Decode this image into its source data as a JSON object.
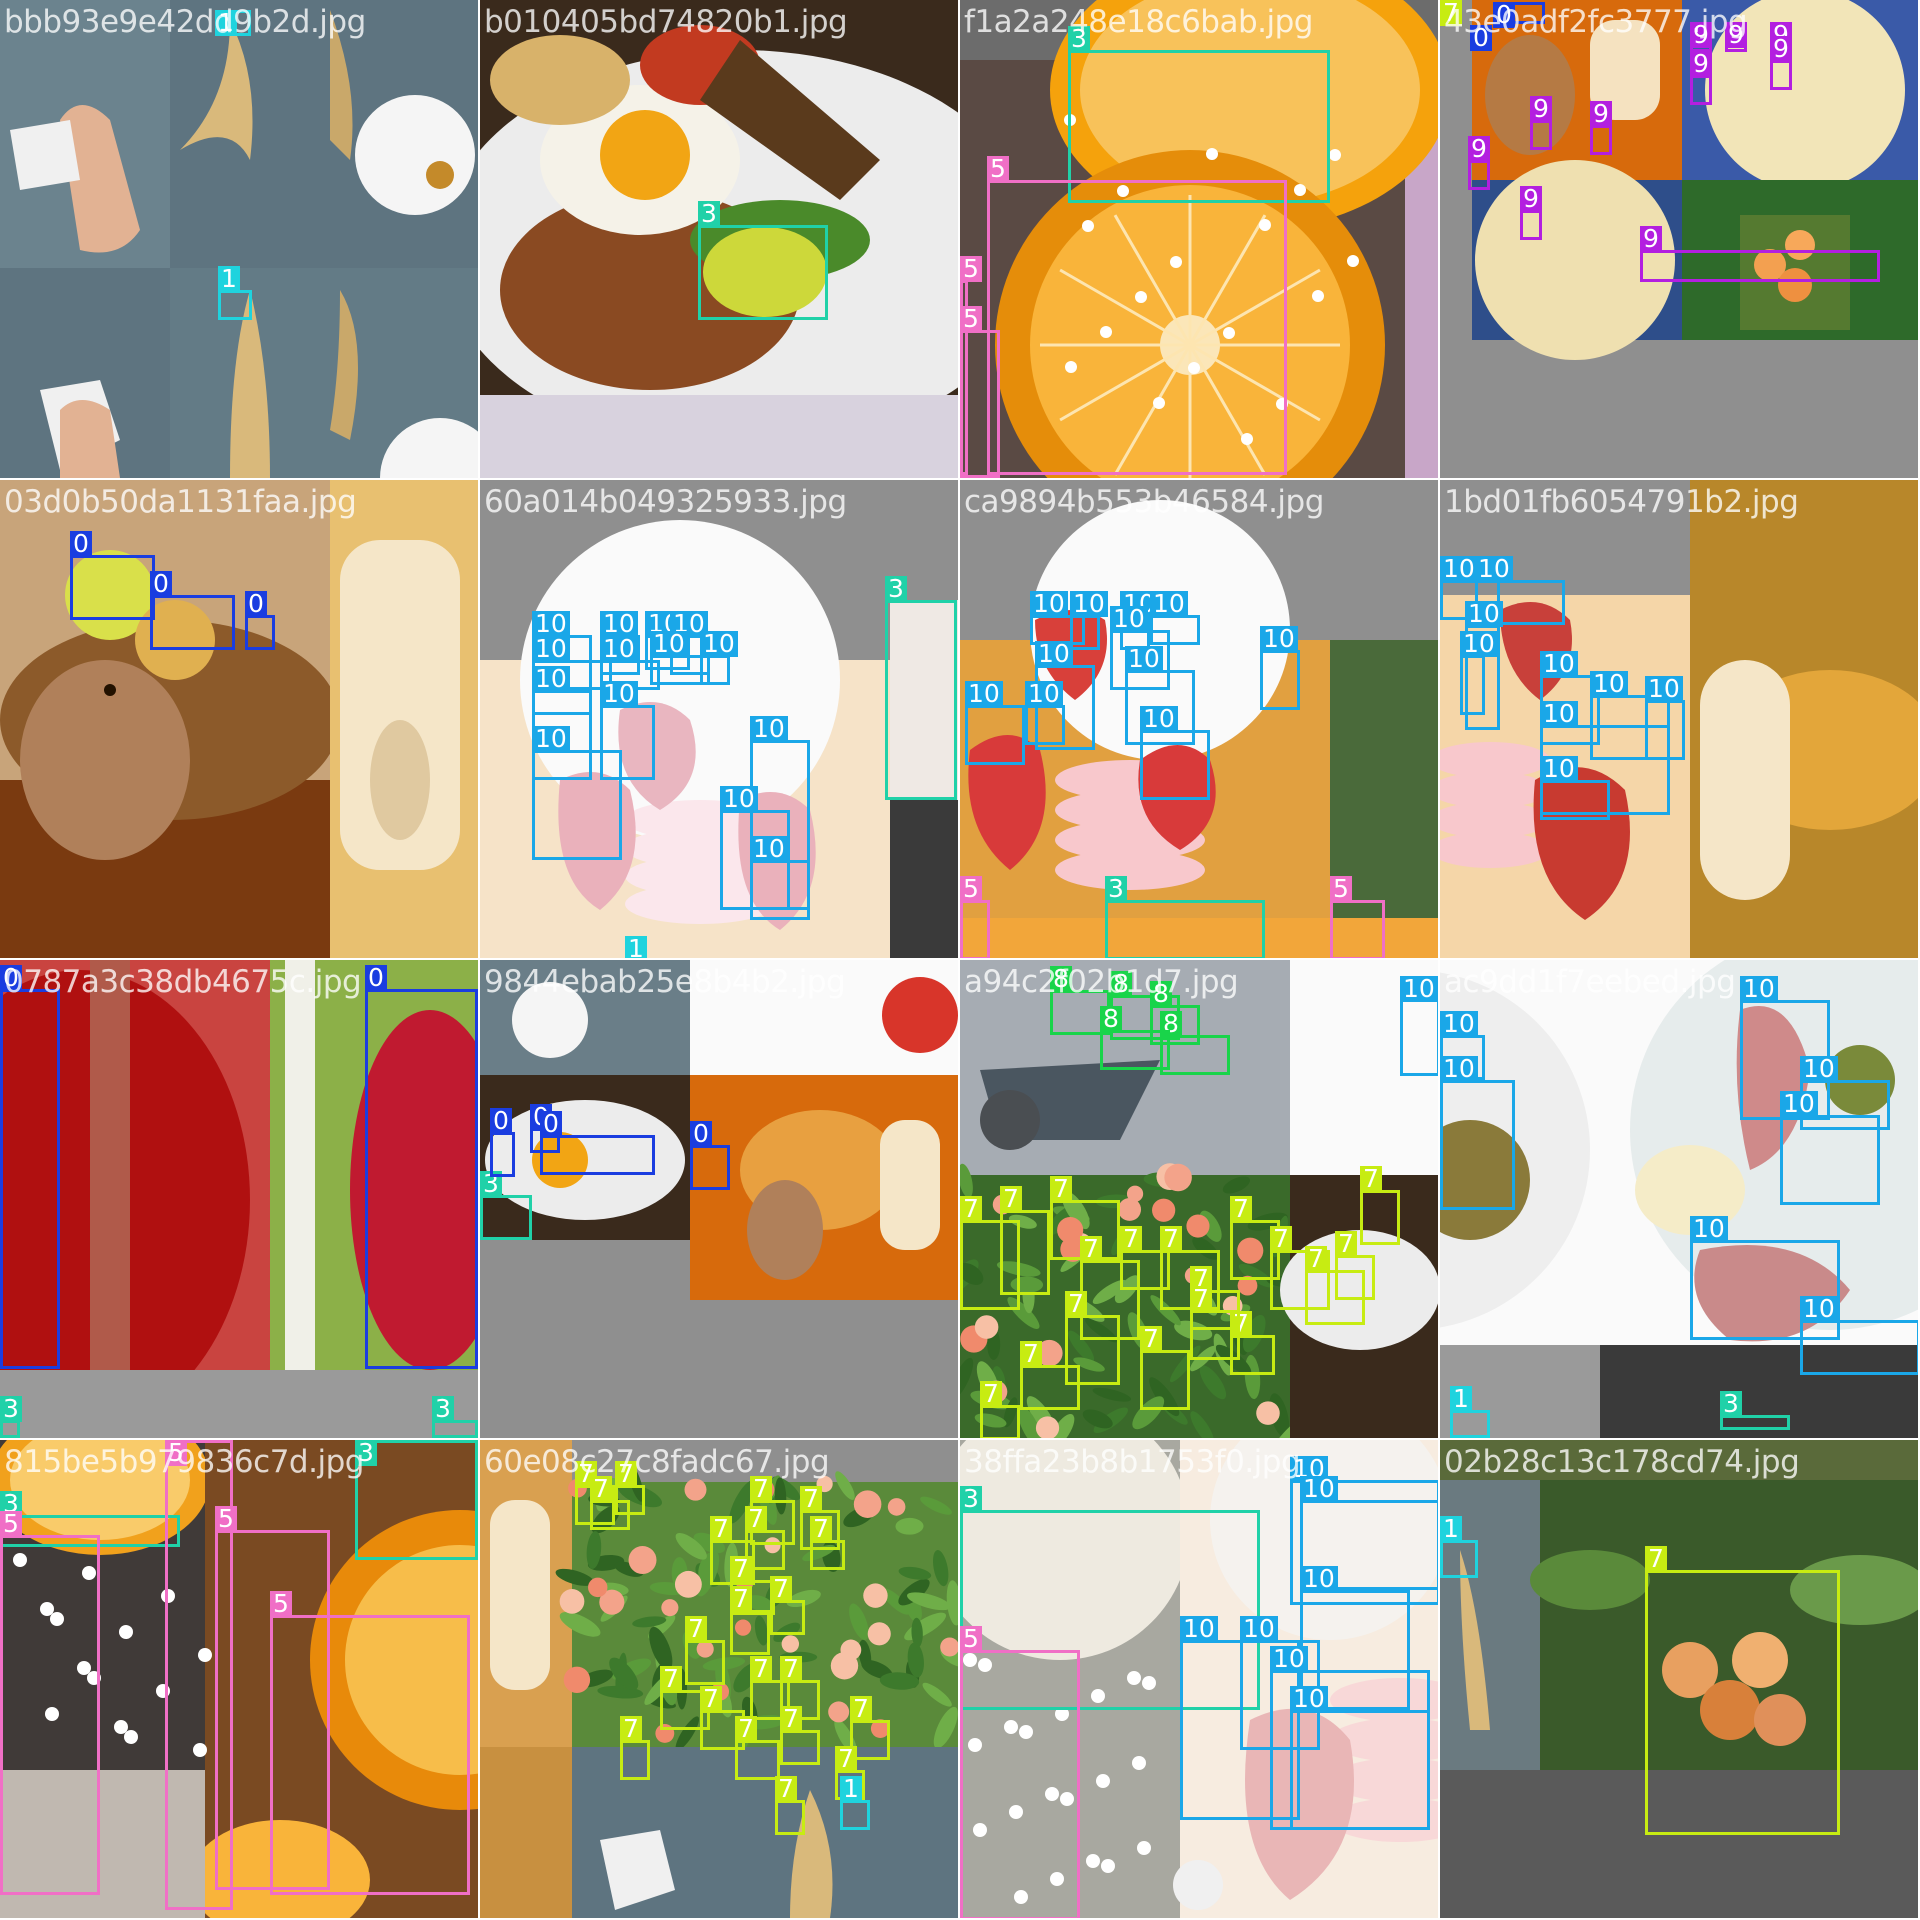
{
  "colors": {
    "0": "#1a3de0",
    "1": "#1fd3de",
    "3": "#20d1a8",
    "5": "#f06fc6",
    "7": "#c7ec12",
    "8": "#19d44a",
    "9": "#b31fe0",
    "10": "#1aa7e8",
    "gray_fill": "#8f8f8f"
  },
  "tiles": [
    {
      "name": "bbb93e9e42dd9b2d.jpg",
      "scene": "banana",
      "boxes": [
        {
          "cls": "1"
        },
        {
          "cls": "1"
        }
      ]
    },
    {
      "name": "b010405bd74820b1.jpg",
      "scene": "plate",
      "boxes": [
        {
          "cls": "3"
        }
      ]
    },
    {
      "name": "f1a2a248e18c6bab.jpg",
      "scene": "orange",
      "boxes": [
        {
          "cls": "3"
        },
        {
          "cls": "5"
        },
        {
          "cls": "5"
        },
        {
          "cls": "5"
        }
      ]
    },
    {
      "name": "43e0adf2fc3777.jpg",
      "scene": "quiche",
      "boxes": [
        {
          "cls": "0"
        },
        {
          "cls": "0"
        },
        {
          "cls": "9"
        },
        {
          "cls": "9"
        },
        {
          "cls": "9"
        },
        {
          "cls": "9"
        },
        {
          "cls": "9"
        },
        {
          "cls": "9"
        },
        {
          "cls": "9"
        },
        {
          "cls": "9"
        },
        {
          "cls": "9"
        },
        {
          "cls": "9"
        },
        {
          "cls": "7"
        }
      ]
    },
    {
      "name": "03d0b50da1131faa.jpg",
      "scene": "hamster",
      "boxes": [
        {
          "cls": "0"
        },
        {
          "cls": "0"
        },
        {
          "cls": "0"
        }
      ]
    },
    {
      "name": "60a014b049325933.jpg",
      "scene": "macaron-pale",
      "boxes": [
        {
          "cls": "10"
        },
        {
          "cls": "10"
        },
        {
          "cls": "10"
        },
        {
          "cls": "10"
        },
        {
          "cls": "10"
        },
        {
          "cls": "10"
        },
        {
          "cls": "10"
        },
        {
          "cls": "10"
        },
        {
          "cls": "10"
        },
        {
          "cls": "10"
        },
        {
          "cls": "10"
        },
        {
          "cls": "10"
        },
        {
          "cls": "10"
        },
        {
          "cls": "10"
        },
        {
          "cls": "3"
        },
        {
          "cls": "1"
        }
      ]
    },
    {
      "name": "ca9894b553b46584.jpg",
      "scene": "macaron",
      "boxes": [
        {
          "cls": "10"
        },
        {
          "cls": "10"
        },
        {
          "cls": "10"
        },
        {
          "cls": "10"
        },
        {
          "cls": "10"
        },
        {
          "cls": "10"
        },
        {
          "cls": "10"
        },
        {
          "cls": "10"
        },
        {
          "cls": "10"
        },
        {
          "cls": "10"
        },
        {
          "cls": "10"
        },
        {
          "cls": "5"
        },
        {
          "cls": "3"
        },
        {
          "cls": "5"
        }
      ]
    },
    {
      "name": "1bd01fb6054791b2.jpg",
      "scene": "macaron-side",
      "boxes": [
        {
          "cls": "10"
        },
        {
          "cls": "10"
        },
        {
          "cls": "10"
        },
        {
          "cls": "10"
        },
        {
          "cls": "10"
        },
        {
          "cls": "10"
        },
        {
          "cls": "10"
        },
        {
          "cls": "10"
        },
        {
          "cls": "10"
        }
      ]
    },
    {
      "name": "0787a3c38db4675c.jpg",
      "scene": "apple",
      "boxes": [
        {
          "cls": "0"
        },
        {
          "cls": "0"
        },
        {
          "cls": "3"
        },
        {
          "cls": "3"
        }
      ]
    },
    {
      "name": "9844ebab25e8b4b2.jpg",
      "scene": "mixed",
      "boxes": [
        {
          "cls": "3"
        },
        {
          "cls": "0"
        },
        {
          "cls": "0"
        },
        {
          "cls": "0"
        },
        {
          "cls": "0"
        }
      ]
    },
    {
      "name": "a94c2f02b1d7.jpg",
      "scene": "peach-tree",
      "boxes": [
        {
          "cls": "8"
        },
        {
          "cls": "8"
        },
        {
          "cls": "8"
        },
        {
          "cls": "8"
        },
        {
          "cls": "8"
        },
        {
          "cls": "10"
        },
        {
          "cls": "7"
        },
        {
          "cls": "7"
        },
        {
          "cls": "7"
        },
        {
          "cls": "7"
        },
        {
          "cls": "7"
        },
        {
          "cls": "7"
        },
        {
          "cls": "7"
        },
        {
          "cls": "7"
        },
        {
          "cls": "7"
        },
        {
          "cls": "7"
        },
        {
          "cls": "7"
        },
        {
          "cls": "7"
        },
        {
          "cls": "7"
        },
        {
          "cls": "7"
        },
        {
          "cls": "7"
        },
        {
          "cls": "7"
        },
        {
          "cls": "7"
        },
        {
          "cls": "7"
        }
      ]
    },
    {
      "name": "ac9dd1f7eebed.jpg",
      "scene": "kiwi",
      "boxes": [
        {
          "cls": "10"
        },
        {
          "cls": "10"
        },
        {
          "cls": "10"
        },
        {
          "cls": "10"
        },
        {
          "cls": "10"
        },
        {
          "cls": "10"
        },
        {
          "cls": "10"
        },
        {
          "cls": "1"
        },
        {
          "cls": "3"
        }
      ]
    },
    {
      "name": "815be5b979836c7d.jpg",
      "scene": "orange-slices",
      "boxes": [
        {
          "cls": "3"
        },
        {
          "cls": "5"
        },
        {
          "cls": "5"
        },
        {
          "cls": "3"
        },
        {
          "cls": "5"
        },
        {
          "cls": "5"
        }
      ]
    },
    {
      "name": "60e08c27c8fadc67.jpg",
      "scene": "peach-orchard",
      "boxes": [
        {
          "cls": "7"
        },
        {
          "cls": "7"
        },
        {
          "cls": "7"
        },
        {
          "cls": "7"
        },
        {
          "cls": "7"
        },
        {
          "cls": "7"
        },
        {
          "cls": "7"
        },
        {
          "cls": "7"
        },
        {
          "cls": "7"
        },
        {
          "cls": "7"
        },
        {
          "cls": "7"
        },
        {
          "cls": "7"
        },
        {
          "cls": "7"
        },
        {
          "cls": "7"
        },
        {
          "cls": "7"
        },
        {
          "cls": "7"
        },
        {
          "cls": "7"
        },
        {
          "cls": "7"
        },
        {
          "cls": "7"
        },
        {
          "cls": "7"
        },
        {
          "cls": "7"
        },
        {
          "cls": "7"
        },
        {
          "cls": "1"
        }
      ]
    },
    {
      "name": "38ffa23b8b1753f0.jpg",
      "scene": "orange-pale",
      "boxes": [
        {
          "cls": "3"
        },
        {
          "cls": "5"
        },
        {
          "cls": "10"
        },
        {
          "cls": "10"
        },
        {
          "cls": "10"
        },
        {
          "cls": "10"
        },
        {
          "cls": "10"
        },
        {
          "cls": "10"
        },
        {
          "cls": "10"
        }
      ]
    },
    {
      "name": "02b28c13c178cd74.jpg",
      "scene": "apricot",
      "boxes": [
        {
          "cls": "1"
        },
        {
          "cls": "7"
        }
      ]
    }
  ]
}
